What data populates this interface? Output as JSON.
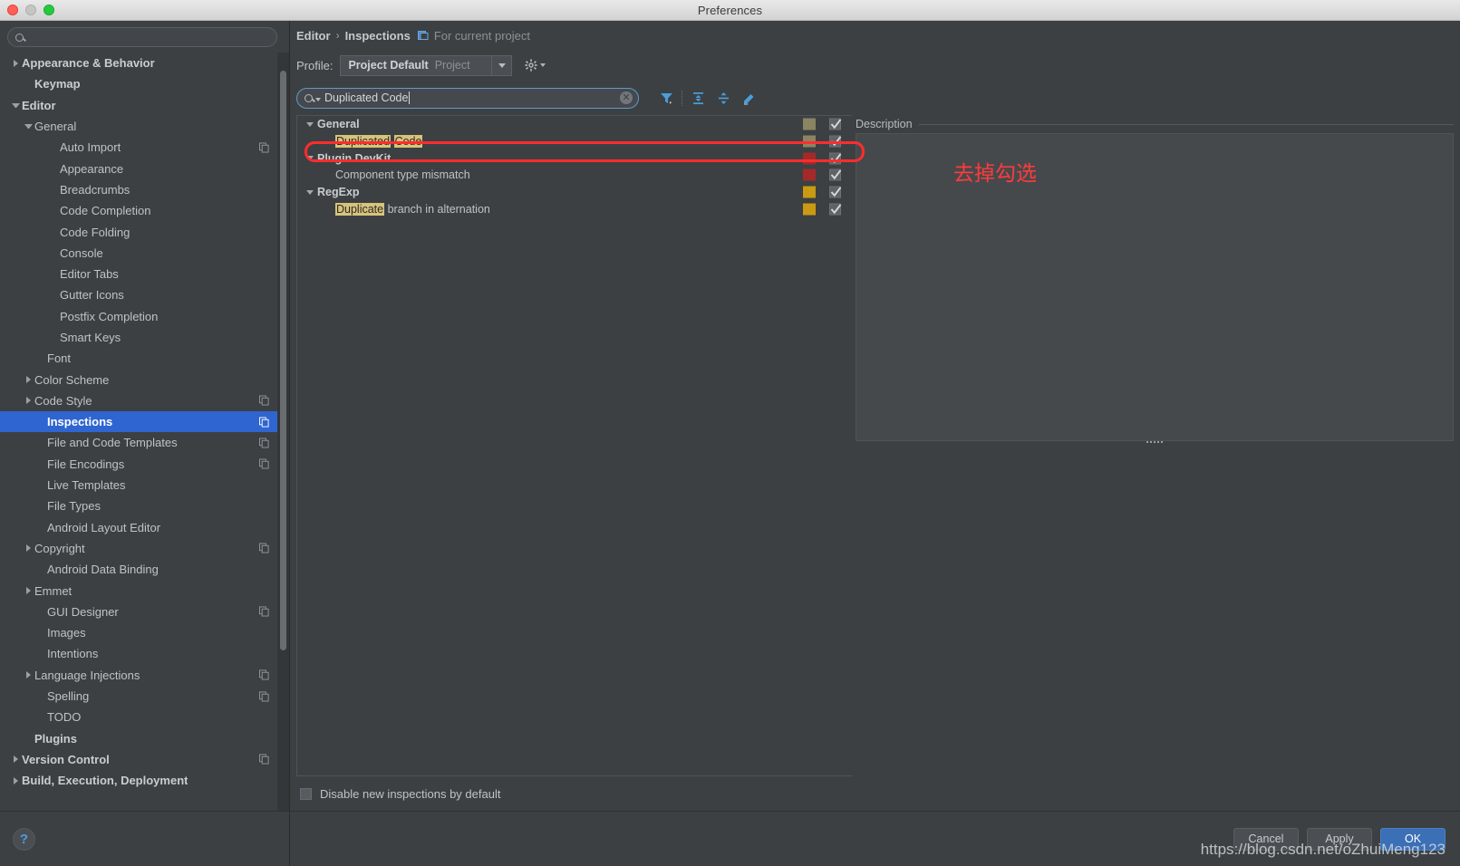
{
  "window": {
    "title": "Preferences",
    "traffic_lights": [
      "close-button",
      "minimize-button",
      "zoom-button"
    ]
  },
  "sidebar": {
    "search": {
      "value": "",
      "placeholder": ""
    },
    "items": [
      {
        "label": "Appearance & Behavior",
        "indent": 0,
        "arrow": "collapsed",
        "bold": true,
        "badge": false,
        "selected": false
      },
      {
        "label": "Keymap",
        "indent": 1,
        "arrow": "none",
        "bold": true,
        "badge": false,
        "selected": false
      },
      {
        "label": "Editor",
        "indent": 0,
        "arrow": "expanded",
        "bold": true,
        "badge": false,
        "selected": false
      },
      {
        "label": "General",
        "indent": 1,
        "arrow": "expanded",
        "bold": false,
        "badge": false,
        "selected": false
      },
      {
        "label": "Auto Import",
        "indent": 3,
        "arrow": "none",
        "bold": false,
        "badge": true,
        "selected": false
      },
      {
        "label": "Appearance",
        "indent": 3,
        "arrow": "none",
        "bold": false,
        "badge": false,
        "selected": false
      },
      {
        "label": "Breadcrumbs",
        "indent": 3,
        "arrow": "none",
        "bold": false,
        "badge": false,
        "selected": false
      },
      {
        "label": "Code Completion",
        "indent": 3,
        "arrow": "none",
        "bold": false,
        "badge": false,
        "selected": false
      },
      {
        "label": "Code Folding",
        "indent": 3,
        "arrow": "none",
        "bold": false,
        "badge": false,
        "selected": false
      },
      {
        "label": "Console",
        "indent": 3,
        "arrow": "none",
        "bold": false,
        "badge": false,
        "selected": false
      },
      {
        "label": "Editor Tabs",
        "indent": 3,
        "arrow": "none",
        "bold": false,
        "badge": false,
        "selected": false
      },
      {
        "label": "Gutter Icons",
        "indent": 3,
        "arrow": "none",
        "bold": false,
        "badge": false,
        "selected": false
      },
      {
        "label": "Postfix Completion",
        "indent": 3,
        "arrow": "none",
        "bold": false,
        "badge": false,
        "selected": false
      },
      {
        "label": "Smart Keys",
        "indent": 3,
        "arrow": "none",
        "bold": false,
        "badge": false,
        "selected": false
      },
      {
        "label": "Font",
        "indent": 2,
        "arrow": "none",
        "bold": false,
        "badge": false,
        "selected": false
      },
      {
        "label": "Color Scheme",
        "indent": 1,
        "arrow": "collapsed",
        "bold": false,
        "badge": false,
        "selected": false
      },
      {
        "label": "Code Style",
        "indent": 1,
        "arrow": "collapsed",
        "bold": false,
        "badge": true,
        "selected": false
      },
      {
        "label": "Inspections",
        "indent": 2,
        "arrow": "none",
        "bold": true,
        "badge": true,
        "selected": true
      },
      {
        "label": "File and Code Templates",
        "indent": 2,
        "arrow": "none",
        "bold": false,
        "badge": true,
        "selected": false
      },
      {
        "label": "File Encodings",
        "indent": 2,
        "arrow": "none",
        "bold": false,
        "badge": true,
        "selected": false
      },
      {
        "label": "Live Templates",
        "indent": 2,
        "arrow": "none",
        "bold": false,
        "badge": false,
        "selected": false
      },
      {
        "label": "File Types",
        "indent": 2,
        "arrow": "none",
        "bold": false,
        "badge": false,
        "selected": false
      },
      {
        "label": "Android Layout Editor",
        "indent": 2,
        "arrow": "none",
        "bold": false,
        "badge": false,
        "selected": false
      },
      {
        "label": "Copyright",
        "indent": 1,
        "arrow": "collapsed",
        "bold": false,
        "badge": true,
        "selected": false
      },
      {
        "label": "Android Data Binding",
        "indent": 2,
        "arrow": "none",
        "bold": false,
        "badge": false,
        "selected": false
      },
      {
        "label": "Emmet",
        "indent": 1,
        "arrow": "collapsed",
        "bold": false,
        "badge": false,
        "selected": false
      },
      {
        "label": "GUI Designer",
        "indent": 2,
        "arrow": "none",
        "bold": false,
        "badge": true,
        "selected": false
      },
      {
        "label": "Images",
        "indent": 2,
        "arrow": "none",
        "bold": false,
        "badge": false,
        "selected": false
      },
      {
        "label": "Intentions",
        "indent": 2,
        "arrow": "none",
        "bold": false,
        "badge": false,
        "selected": false
      },
      {
        "label": "Language Injections",
        "indent": 1,
        "arrow": "collapsed",
        "bold": false,
        "badge": true,
        "selected": false
      },
      {
        "label": "Spelling",
        "indent": 2,
        "arrow": "none",
        "bold": false,
        "badge": true,
        "selected": false
      },
      {
        "label": "TODO",
        "indent": 2,
        "arrow": "none",
        "bold": false,
        "badge": false,
        "selected": false
      },
      {
        "label": "Plugins",
        "indent": 1,
        "arrow": "none",
        "bold": true,
        "badge": false,
        "selected": false
      },
      {
        "label": "Version Control",
        "indent": 0,
        "arrow": "collapsed",
        "bold": true,
        "badge": true,
        "selected": false
      },
      {
        "label": "Build, Execution, Deployment",
        "indent": 0,
        "arrow": "collapsed",
        "bold": true,
        "badge": false,
        "selected": false
      }
    ],
    "help_label": "?"
  },
  "breadcrumb": {
    "root": "Editor",
    "separator": "›",
    "current": "Inspections",
    "note": "For current project"
  },
  "profile": {
    "label": "Profile:",
    "selected": "Project Default",
    "scope": "Project",
    "gear_icon": "gear-icon"
  },
  "inspection_filter": {
    "query": "Duplicated Code",
    "placeholder": "",
    "clear_icon": "clear-icon",
    "tools": [
      {
        "name": "filter-icon",
        "label": "Filter"
      },
      {
        "name": "expand-all-icon",
        "label": "Expand All"
      },
      {
        "name": "collapse-all-icon",
        "label": "Collapse All"
      },
      {
        "name": "reset-icon",
        "label": "Reset"
      }
    ]
  },
  "inspections": {
    "rows": [
      {
        "label": "General",
        "type": "group",
        "severity_color": "#8a8463",
        "checked": true,
        "highlights": []
      },
      {
        "label": "Duplicated Code",
        "type": "child",
        "severity_color": "#8a8463",
        "checked": true,
        "highlights": [
          "Duplicated",
          "Code"
        ],
        "annotated": true
      },
      {
        "label": "Plugin DevKit",
        "type": "group",
        "severity_color": "#a42a2a",
        "checked": true,
        "highlights": []
      },
      {
        "label": "Component type mismatch",
        "type": "child",
        "severity_color": "#a42a2a",
        "checked": true,
        "highlights": []
      },
      {
        "label": "RegExp",
        "type": "group",
        "severity_color": "#c99a12",
        "checked": true,
        "highlights": []
      },
      {
        "label": "Duplicate branch in alternation",
        "type": "child",
        "severity_color": "#c99a12",
        "checked": true,
        "highlights": [
          "Duplicate"
        ]
      }
    ]
  },
  "description": {
    "title": "Description",
    "body": ""
  },
  "options": {
    "disable_new_label": "Disable new inspections by default",
    "disable_new_checked": false
  },
  "footer": {
    "cancel": "Cancel",
    "apply": "Apply",
    "ok": "OK"
  },
  "annotations": {
    "note_cn": "去掉勾选",
    "color": "#ff2d2d"
  },
  "watermark": "https://blog.csdn.net/oZhuiMeng123",
  "colors": {
    "accent_selected": "#2f65d0",
    "primary_button": "#3b6fb6",
    "highlight_match": "#d9c37a",
    "annotation_red": "#ff2d2d",
    "bg": "#3c4043"
  }
}
